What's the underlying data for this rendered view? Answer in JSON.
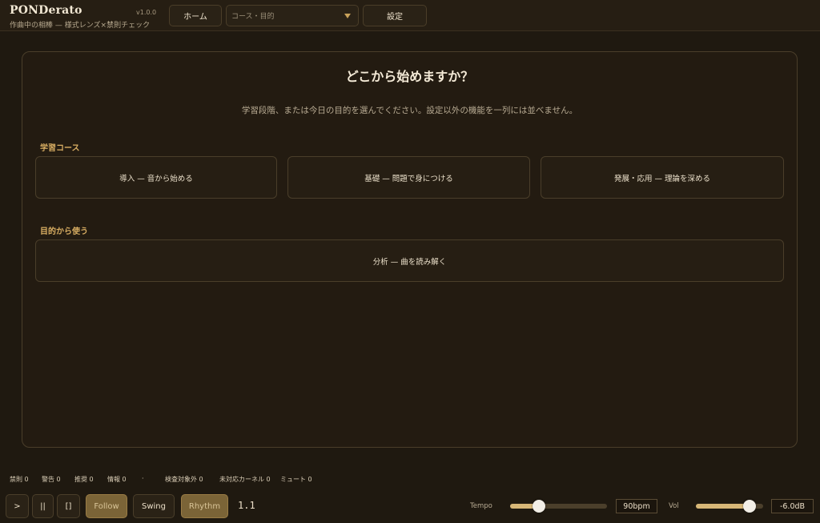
{
  "app": {
    "title": "PONDerato",
    "tagline": "作曲中の相棒 — 様式レンズ×禁則チェック",
    "version": "v1.0.0"
  },
  "header": {
    "home_label": "ホーム",
    "course_select": {
      "placeholder": "コース・目的"
    },
    "settings_label": "設定"
  },
  "main": {
    "title": "どこから始めますか？",
    "subtitle": "学習段階、または今日の目的を選んでください。設定以外の機能を一列には並べません。",
    "sections": [
      {
        "label": "学習コース",
        "items": [
          "導入 — 音から始める",
          "基礎 — 問題で身につける",
          "発展・応用 — 理論を深める"
        ]
      },
      {
        "label": "目的から使う",
        "items": [
          "分析 — 曲を読み解く"
        ]
      }
    ]
  },
  "status": [
    {
      "label": "禁則 0"
    },
    {
      "label": "警告 0"
    },
    {
      "label": "推奨 0"
    },
    {
      "label": "情報 0"
    },
    {
      "label": "·"
    },
    {
      "label": "検査対象外 0"
    },
    {
      "label": "未対応カーネル 0"
    },
    {
      "label": "ミュート 0"
    }
  ],
  "transport": {
    "play_label": ">",
    "pause_label": "||",
    "stop_label": "[]",
    "follow_label": "Follow",
    "swing_label": "Swing",
    "rhythm_label": "Rhythm",
    "position": "1.1",
    "tempo": {
      "label": "Tempo",
      "value": "90bpm",
      "level": 0.3
    },
    "volume": {
      "label": "Vol",
      "value": "-6.0dB",
      "level": 0.8
    }
  },
  "colors": {
    "background": "#1f1910",
    "accent": "#d9ae63",
    "active_button": "#7b6437",
    "slider_fill": "#d7b777"
  }
}
